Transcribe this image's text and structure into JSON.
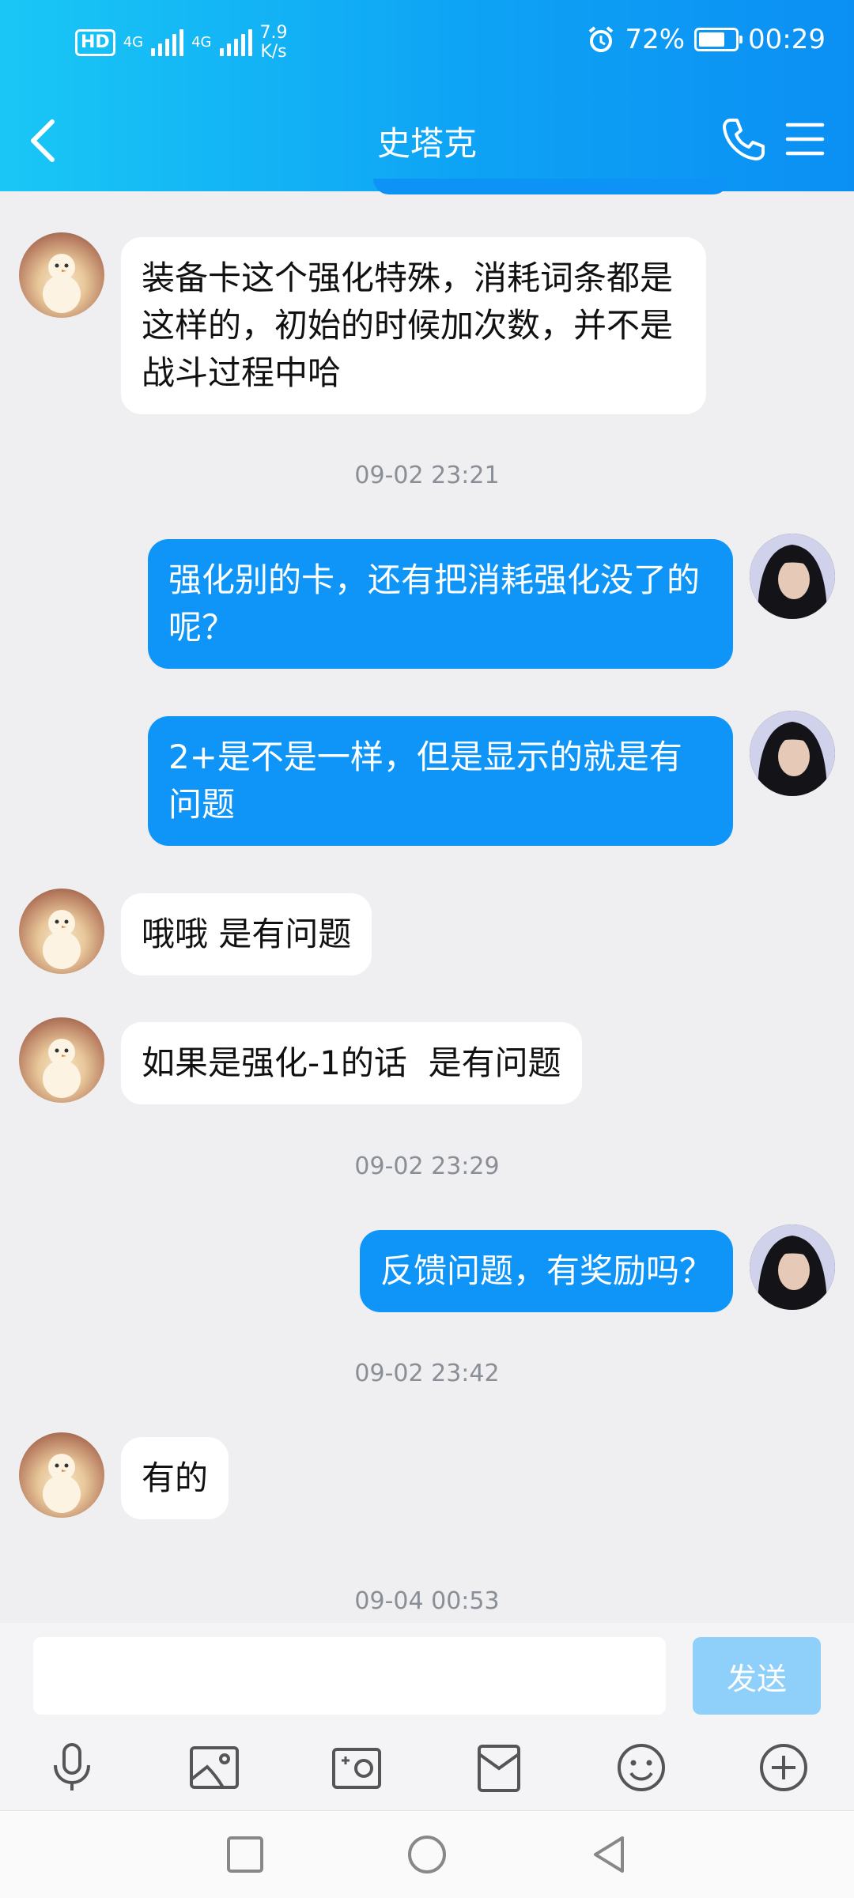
{
  "status_bar": {
    "hd": "HD",
    "sim1": "4G",
    "sim2": "4G",
    "speed_value": "7.9",
    "speed_unit": "K/s",
    "battery": "72%",
    "time": "00:29",
    "battery_level": 0.72
  },
  "header": {
    "title": "史塔克"
  },
  "messages": [
    {
      "side": "in",
      "text": "装备卡这个强化特殊，消耗词条都是这样的，初始的时候加次数，并不是战斗过程中哈"
    },
    {
      "type": "time",
      "text": "09-02 23:21"
    },
    {
      "side": "out",
      "text": "强化别的卡，还有把消耗强化没了的呢？"
    },
    {
      "side": "out",
      "text": "2+是不是一样，但是显示的就是有问题"
    },
    {
      "side": "in",
      "text": "哦哦 是有问题"
    },
    {
      "side": "in",
      "text": "如果是强化-1的话  是有问题"
    },
    {
      "type": "time",
      "text": "09-02 23:29"
    },
    {
      "side": "out",
      "text": "反馈问题，有奖励吗？"
    },
    {
      "type": "time",
      "text": "09-02 23:42"
    },
    {
      "side": "in",
      "text": "有的"
    },
    {
      "type": "time",
      "text": "09-04 00:53"
    }
  ],
  "input": {
    "value": "",
    "send_label": "发送"
  },
  "toolbar": [
    "microphone-icon",
    "image-icon",
    "camera-icon",
    "file-icon",
    "emoji-icon",
    "plus-icon"
  ],
  "colors": {
    "accent": "#0f95f7",
    "send_disabled": "#8fd0fa",
    "chat_bg": "#efeff1"
  }
}
